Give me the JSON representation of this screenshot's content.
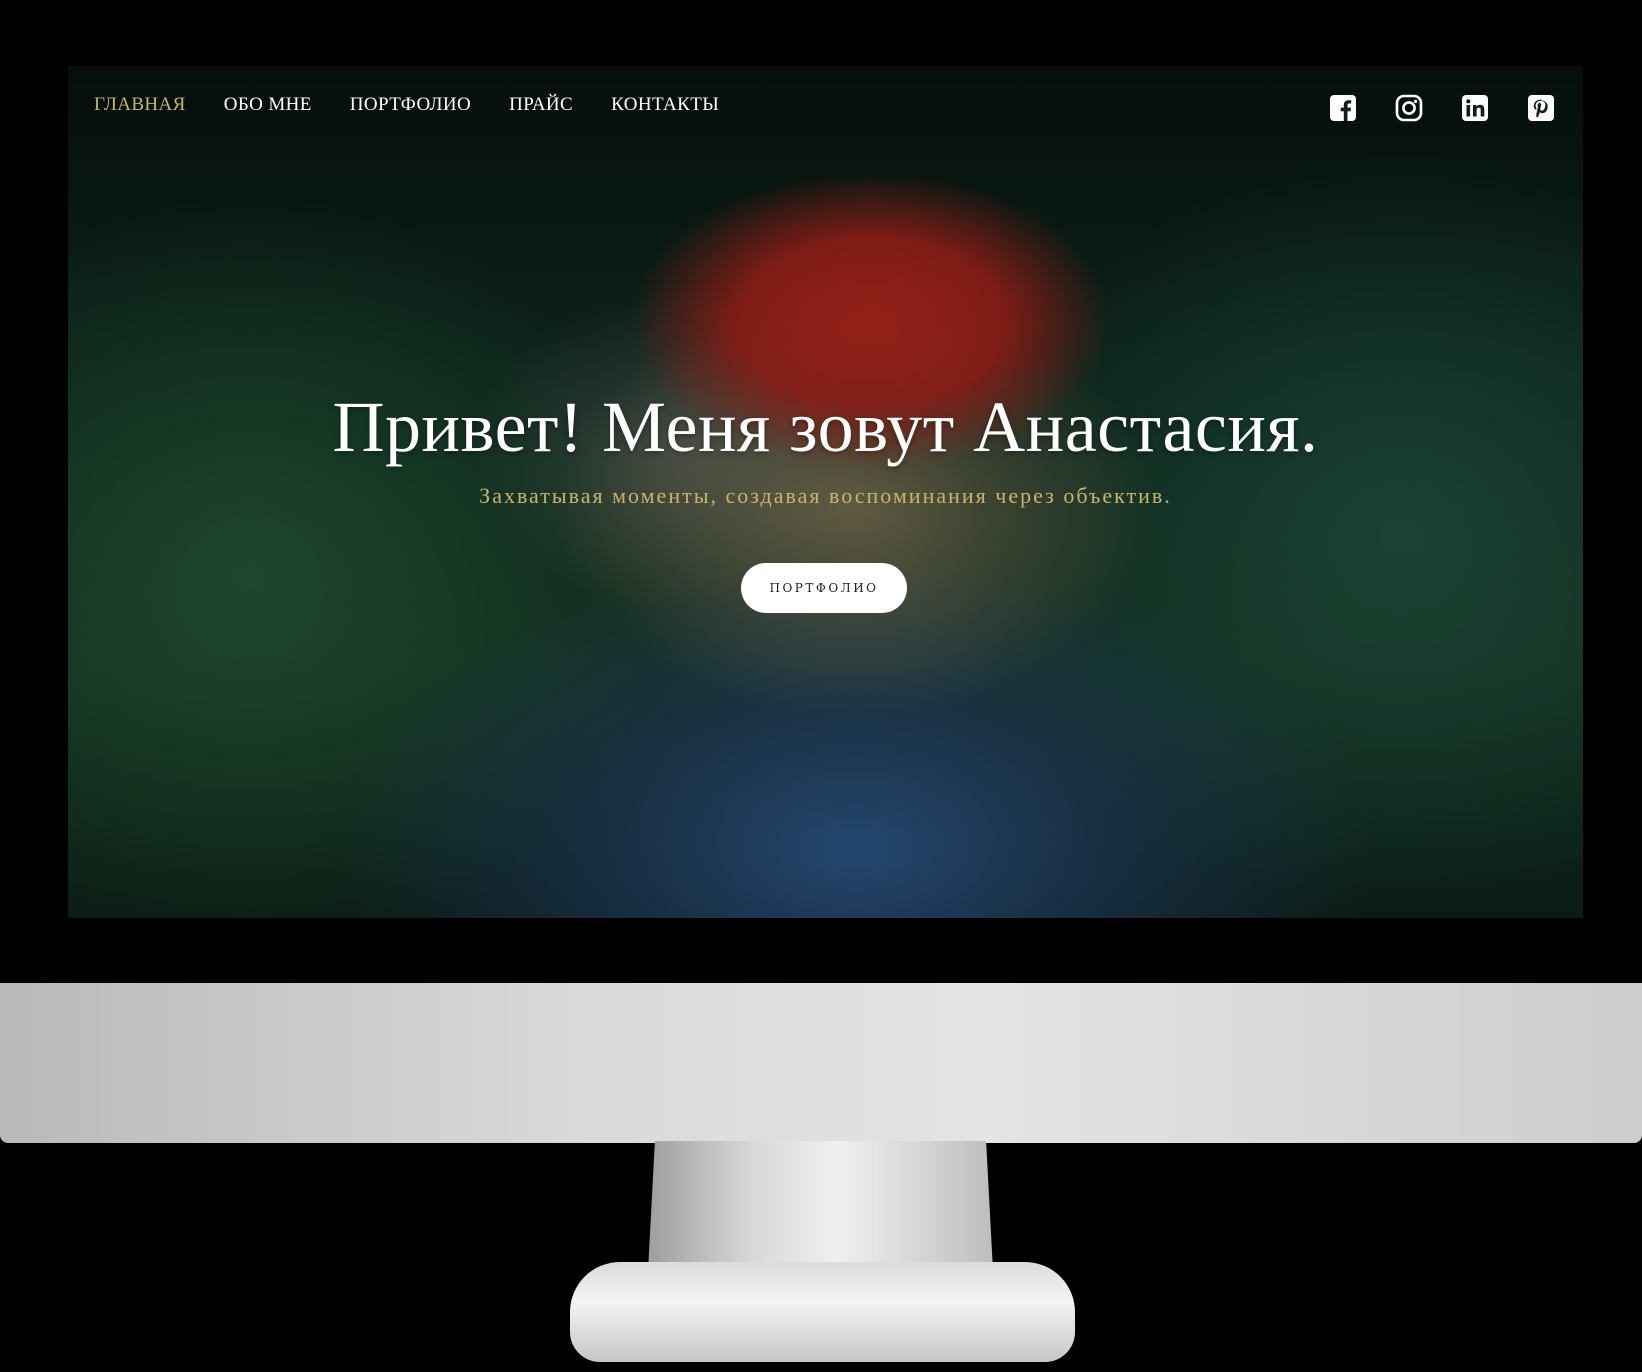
{
  "nav": {
    "items": [
      {
        "label": "ГЛАВНАЯ",
        "active": true
      },
      {
        "label": "ОБО МНЕ",
        "active": false
      },
      {
        "label": "ПОРТФОЛИО",
        "active": false
      },
      {
        "label": "ПРАЙС",
        "active": false
      },
      {
        "label": "КОНТАКТЫ",
        "active": false
      }
    ]
  },
  "social": {
    "icons": [
      "facebook-icon",
      "instagram-icon",
      "linkedin-icon",
      "pinterest-icon"
    ]
  },
  "hero": {
    "title": "Привет! Меня зовут Анастасия.",
    "subtitle": "Захватывая моменты, создавая воспоминания через объектив.",
    "cta_label": "ПОРТФОЛИО"
  },
  "colors": {
    "accent": "#c9b46a",
    "text": "#ffffff",
    "button_bg": "#ffffff"
  }
}
